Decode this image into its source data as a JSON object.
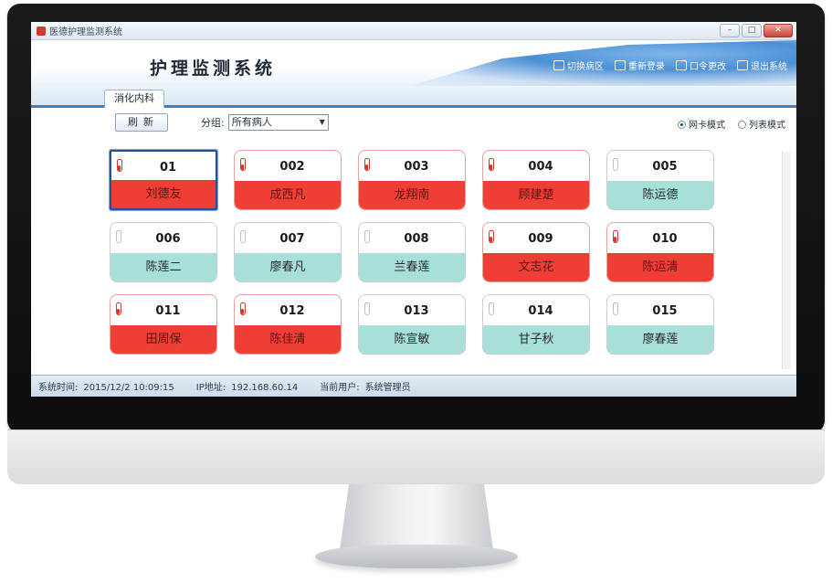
{
  "window": {
    "title": "医德护理监测系统",
    "controls": [
      "–",
      "□",
      "✕"
    ]
  },
  "header": {
    "title": "护理监测系统",
    "toolbar": [
      {
        "label": "切换病区",
        "icon": "switch-ward-icon"
      },
      {
        "label": "重新登录",
        "icon": "relogin-icon"
      },
      {
        "label": "口令更改",
        "icon": "password-icon"
      },
      {
        "label": "退出系统",
        "icon": "exit-icon"
      }
    ]
  },
  "tabs": [
    {
      "label": "消化内科"
    }
  ],
  "filter": {
    "refresh_label": "刷新",
    "group_label": "分组:",
    "group_value": "所有病人",
    "view_modes": [
      {
        "label": "网卡模式",
        "selected": true
      },
      {
        "label": "列表模式",
        "selected": false
      }
    ]
  },
  "beds": [
    {
      "no": "01",
      "name": "刘德友",
      "status": "alert",
      "selected": true
    },
    {
      "no": "002",
      "name": "成西凡",
      "status": "alert"
    },
    {
      "no": "003",
      "name": "龙翔南",
      "status": "alert"
    },
    {
      "no": "004",
      "name": "顾建楚",
      "status": "alert"
    },
    {
      "no": "005",
      "name": "陈运德",
      "status": "normal"
    },
    {
      "no": "006",
      "name": "陈莲二",
      "status": "normal"
    },
    {
      "no": "007",
      "name": "廖春凡",
      "status": "normal"
    },
    {
      "no": "008",
      "name": "兰春莲",
      "status": "normal"
    },
    {
      "no": "009",
      "name": "文志花",
      "status": "alert"
    },
    {
      "no": "010",
      "name": "陈运清",
      "status": "alert"
    },
    {
      "no": "011",
      "name": "田周保",
      "status": "alert"
    },
    {
      "no": "012",
      "name": "陈佳清",
      "status": "alert"
    },
    {
      "no": "013",
      "name": "陈宣敏",
      "status": "normal"
    },
    {
      "no": "014",
      "name": "甘子秋",
      "status": "normal"
    },
    {
      "no": "015",
      "name": "廖春莲",
      "status": "normal"
    }
  ],
  "status_bar": {
    "time_label": "系统时间:",
    "time_value": "2015/12/2 10:09:15",
    "ip_label": "IP地址:",
    "ip_value": "192.168.60.14",
    "user_label": "当前用户:",
    "user_value": "系统管理员"
  },
  "colors": {
    "alert": "#ef3e36",
    "normal": "#a6e0d8",
    "accent": "#3d7fc4"
  }
}
